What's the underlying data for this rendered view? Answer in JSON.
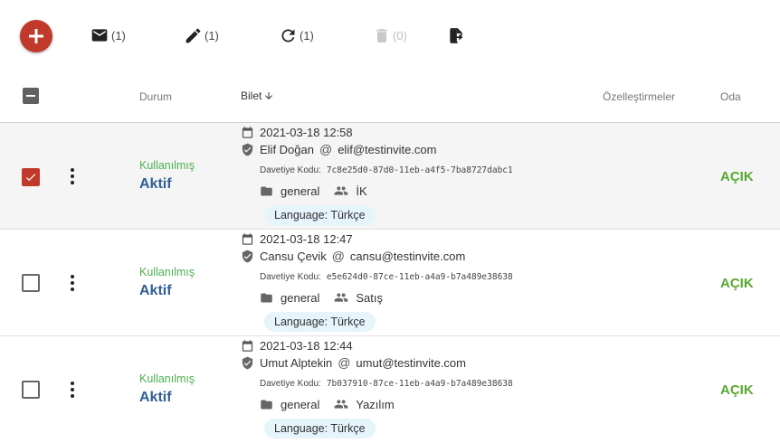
{
  "toolbar": {
    "email_count": "(1)",
    "edit_count": "(1)",
    "refresh_count": "(1)",
    "delete_count": "(0)"
  },
  "header": {
    "status": "Durum",
    "ticket": "Bilet",
    "customizations": "Özelleştirmeler",
    "room": "Oda"
  },
  "rows": [
    {
      "selected": true,
      "status_used": "Kullanılmış",
      "status_active": "Aktif",
      "date": "2021-03-18 12:58",
      "name": "Elif Doğan",
      "email": "elif@testinvite.com",
      "code_label": "Davetiye Kodu:",
      "code": "7c8e25d0-87d0-11eb-a4f5-7ba8727dabc1",
      "folder": "general",
      "group": "İK",
      "language": "Language: Türkçe",
      "room": "AÇIK"
    },
    {
      "selected": false,
      "status_used": "Kullanılmış",
      "status_active": "Aktif",
      "date": "2021-03-18 12:47",
      "name": "Cansu Çevik",
      "email": "cansu@testinvite.com",
      "code_label": "Davetiye Kodu:",
      "code": "e5e624d0-87ce-11eb-a4a9-b7a489e38638",
      "folder": "general",
      "group": "Satış",
      "language": "Language: Türkçe",
      "room": "AÇIK"
    },
    {
      "selected": false,
      "status_used": "Kullanılmış",
      "status_active": "Aktif",
      "date": "2021-03-18 12:44",
      "name": "Umut Alptekin",
      "email": "umut@testinvite.com",
      "code_label": "Davetiye Kodu:",
      "code": "7b037910-87ce-11eb-a4a9-b7a489e38638",
      "folder": "general",
      "group": "Yazılım",
      "language": "Language: Türkçe",
      "room": "AÇIK"
    }
  ],
  "colors": {
    "accent": "#c0392b",
    "used": "#4caf50",
    "active": "#2f5f93",
    "room_open": "#5aa832",
    "chip_bg": "#e6f4fb"
  }
}
